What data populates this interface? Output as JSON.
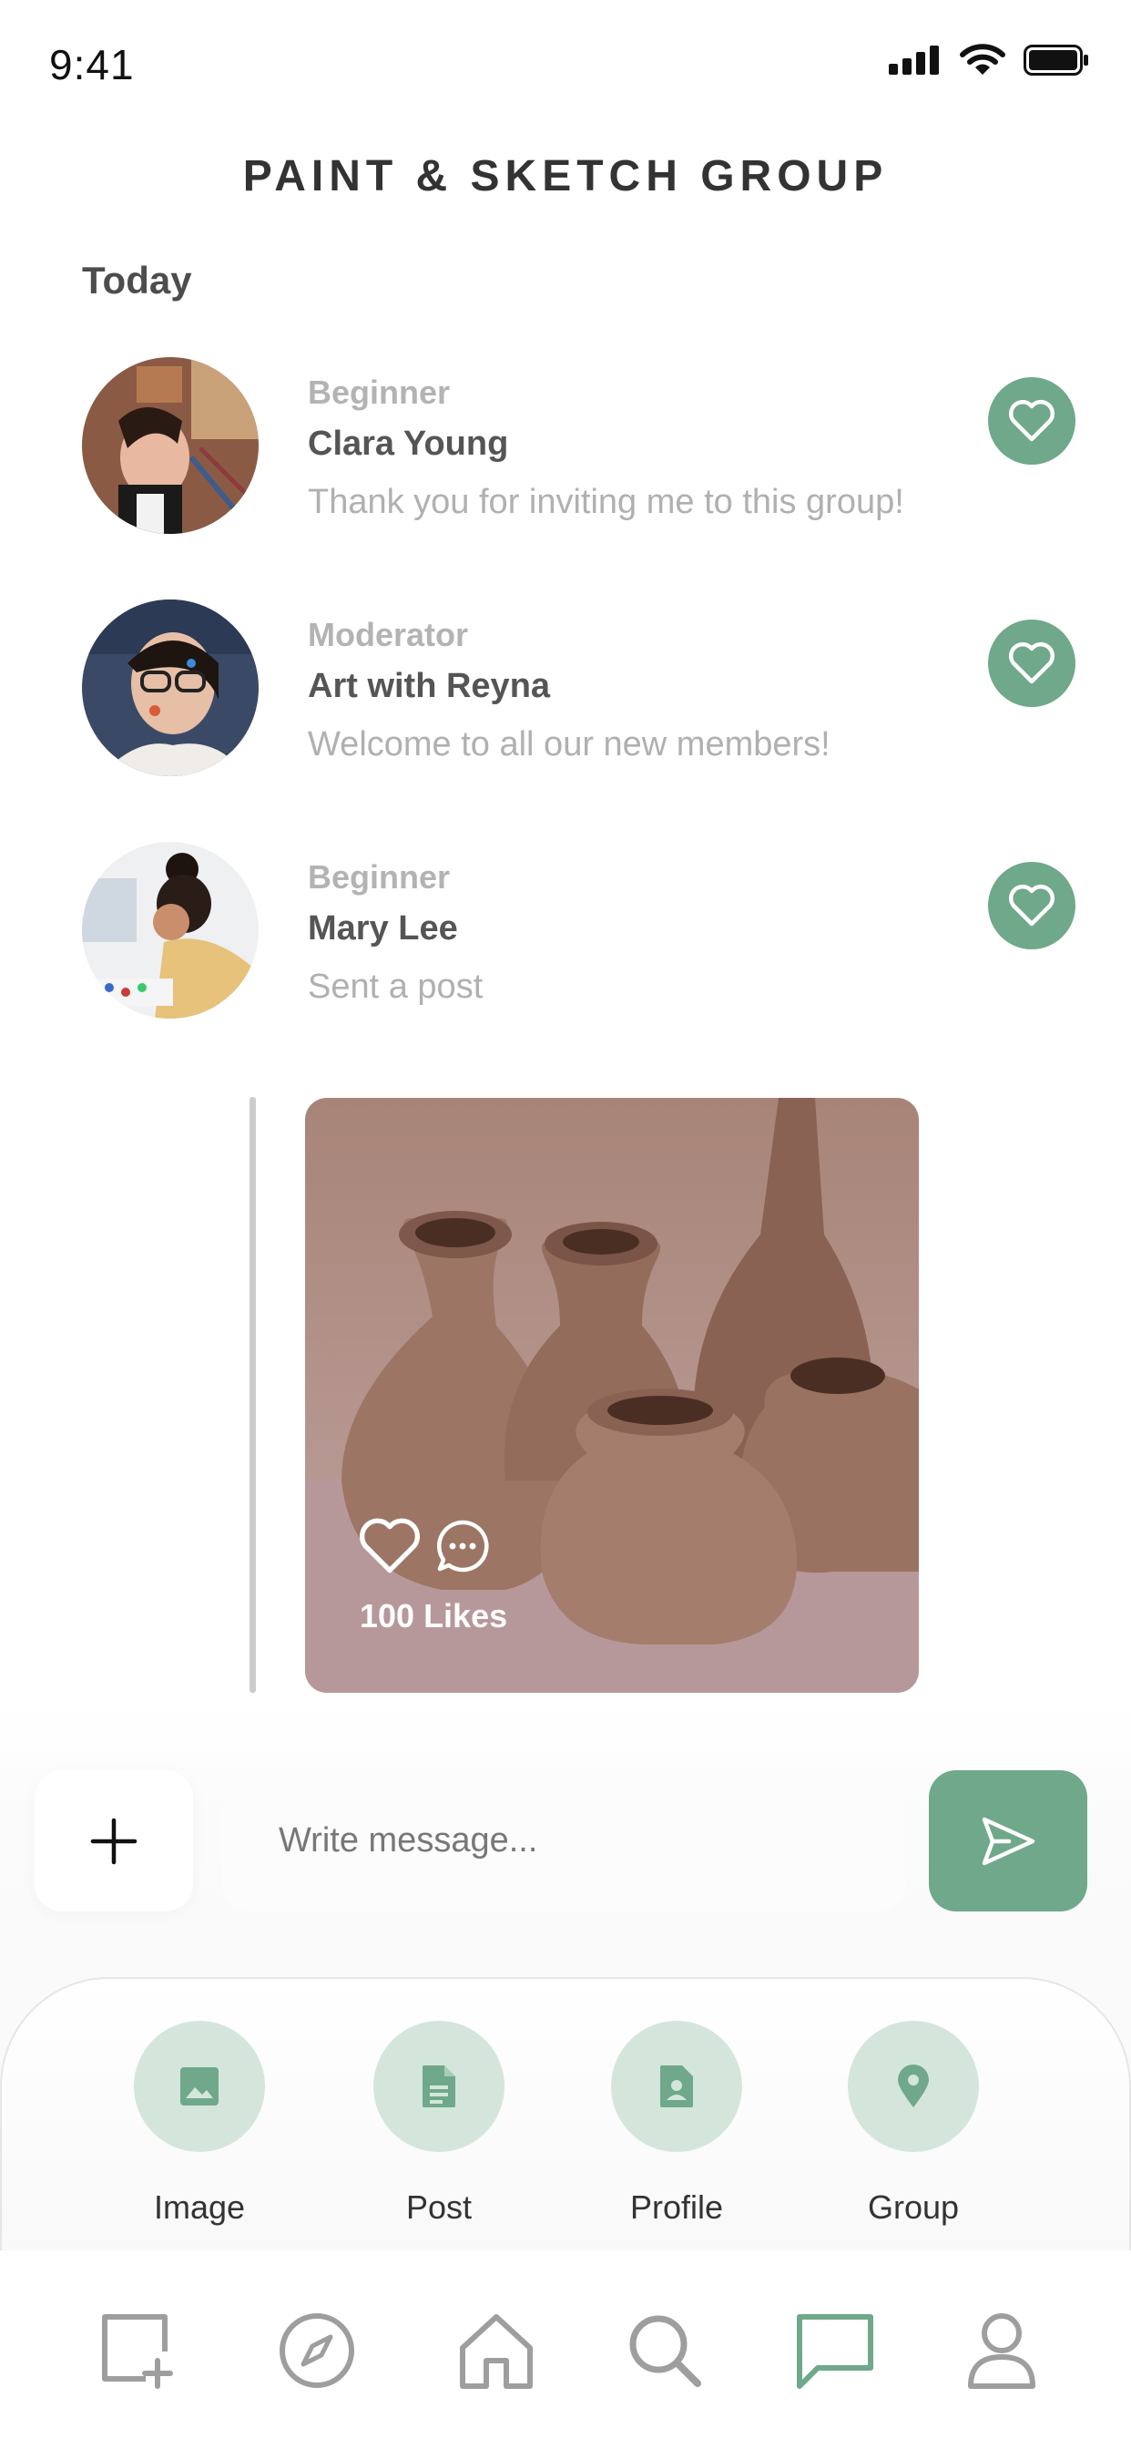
{
  "status_bar": {
    "time": "9:41",
    "signal_icon": "cellular-signal-icon",
    "wifi_icon": "wifi-icon",
    "battery_icon": "battery-icon"
  },
  "page": {
    "title": "PAINT & SKETCH GROUP",
    "section": "Today"
  },
  "messages": [
    {
      "role": "Beginner",
      "name": "Clara Young",
      "text": "Thank you for inviting me to this group!",
      "avatar": "avatar-photo",
      "like_icon": "heart-icon"
    },
    {
      "role": "Moderator",
      "name": "Art with Reyna",
      "text": "Welcome to all our new members!",
      "avatar": "avatar-photo",
      "like_icon": "heart-icon"
    },
    {
      "role": "Beginner",
      "name": "Mary Lee",
      "text": "Sent a post",
      "avatar": "avatar-photo",
      "like_icon": "heart-icon"
    }
  ],
  "post": {
    "likes": "100 Likes",
    "image": "clay-vases-photo",
    "like_icon": "heart-icon",
    "comment_icon": "comment-icon"
  },
  "composer": {
    "placeholder": "Write message...",
    "add_icon": "plus-icon",
    "send_icon": "send-icon"
  },
  "attachments": [
    {
      "label": "Image",
      "icon": "image-icon"
    },
    {
      "label": "Post",
      "icon": "document-icon"
    },
    {
      "label": "Profile",
      "icon": "profile-card-icon"
    },
    {
      "label": "Group",
      "icon": "location-pin-icon"
    }
  ],
  "nav": [
    {
      "icon": "create-post-icon"
    },
    {
      "icon": "compass-icon"
    },
    {
      "icon": "home-icon"
    },
    {
      "icon": "search-icon"
    },
    {
      "icon": "chat-icon",
      "active": true
    },
    {
      "icon": "user-icon"
    }
  ],
  "colors": {
    "accent": "#6fa88a",
    "accent_light": "#d4e6dc",
    "nav_inactive": "#9e9e9e"
  }
}
